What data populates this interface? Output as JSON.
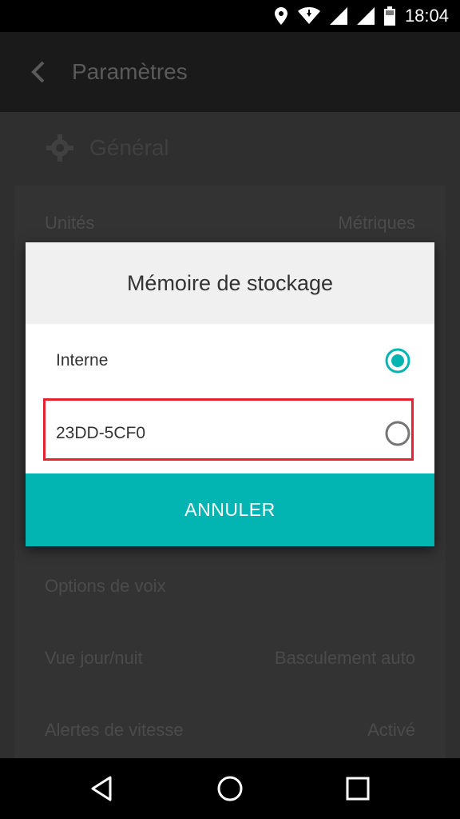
{
  "status_bar": {
    "time": "18:04"
  },
  "app_bar": {
    "title": "Paramètres"
  },
  "section": {
    "title": "Général"
  },
  "settings": {
    "rows": [
      {
        "label": "Unités",
        "value": "Métriques"
      },
      {
        "label": "Options de voix",
        "value": ""
      },
      {
        "label": "Vue jour/nuit",
        "value": "Basculement auto"
      },
      {
        "label": "Alertes de vitesse",
        "value": "Activé"
      }
    ]
  },
  "dialog": {
    "title": "Mémoire de stockage",
    "options": [
      {
        "label": "Interne",
        "selected": true
      },
      {
        "label": "23DD-5CF0",
        "selected": false
      }
    ],
    "cancel_label": "ANNULER"
  },
  "colors": {
    "accent": "#03b5b2",
    "highlight": "#e52230"
  }
}
